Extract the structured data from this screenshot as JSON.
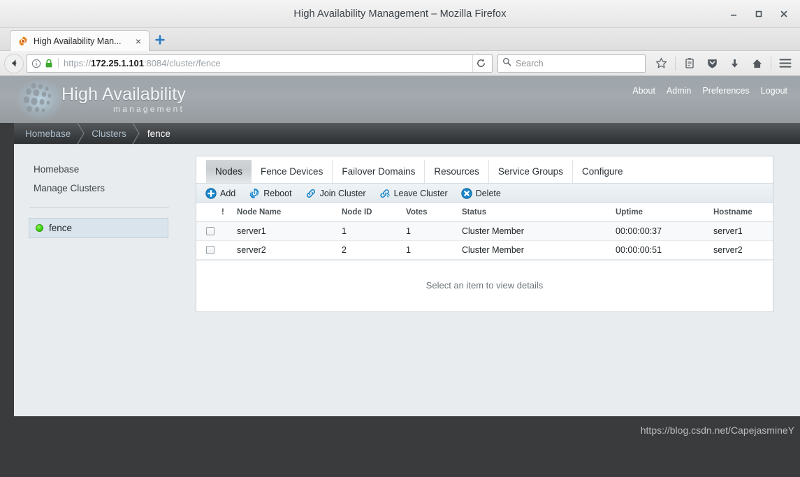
{
  "window": {
    "title": "High Availability Management – Mozilla Firefox",
    "minimize_label": "Minimize",
    "maximize_label": "Maximize",
    "close_label": "Close"
  },
  "browser": {
    "tab": {
      "title": "High Availability Man...",
      "favicon": "gear-icon",
      "close_label": "×"
    },
    "new_tab_label": "+",
    "url": {
      "scheme": "https://",
      "host": "172.25.1.101",
      "path": ":8084/cluster/fence",
      "full": "https://172.25.1.101:8084/cluster/fence"
    },
    "search": {
      "placeholder": "Search"
    },
    "icons": [
      "back-icon",
      "info-icon",
      "lock-icon",
      "reload-icon",
      "search-icon",
      "bookmark-star-icon",
      "reader-icon",
      "pocket-shield-icon",
      "download-icon",
      "home-icon",
      "menu-icon"
    ]
  },
  "header": {
    "brand_title": "High Availability",
    "brand_subtitle": "management",
    "nav": [
      {
        "label": "About"
      },
      {
        "label": "Admin"
      },
      {
        "label": "Preferences"
      },
      {
        "label": "Logout"
      }
    ]
  },
  "breadcrumb": [
    {
      "label": "Homebase",
      "current": false
    },
    {
      "label": "Clusters",
      "current": false
    },
    {
      "label": "fence",
      "current": true
    }
  ],
  "sidebar": {
    "links": [
      {
        "label": "Homebase"
      },
      {
        "label": "Manage Clusters"
      }
    ],
    "clusters": [
      {
        "label": "fence",
        "status": "running",
        "status_color": "#3fc413",
        "selected": true
      }
    ]
  },
  "main": {
    "tabs": [
      {
        "label": "Nodes",
        "active": true
      },
      {
        "label": "Fence Devices",
        "active": false
      },
      {
        "label": "Failover Domains",
        "active": false
      },
      {
        "label": "Resources",
        "active": false
      },
      {
        "label": "Service Groups",
        "active": false
      },
      {
        "label": "Configure",
        "active": false
      }
    ],
    "toolbar": [
      {
        "label": "Add",
        "icon": "plus-circle-icon"
      },
      {
        "label": "Reboot",
        "icon": "gear-power-icon"
      },
      {
        "label": "Join Cluster",
        "icon": "link-icon"
      },
      {
        "label": "Leave Cluster",
        "icon": "broken-link-icon"
      },
      {
        "label": "Delete",
        "icon": "x-circle-icon"
      }
    ],
    "table": {
      "columns": [
        "",
        "!",
        "Node Name",
        "Node ID",
        "Votes",
        "Status",
        "Uptime",
        "Hostname"
      ],
      "rows": [
        {
          "checked": false,
          "alert": "",
          "node_name": "server1",
          "node_id": "1",
          "votes": "1",
          "status": "Cluster Member",
          "uptime": "00:00:00:37",
          "hostname": "server1"
        },
        {
          "checked": false,
          "alert": "",
          "node_name": "server2",
          "node_id": "2",
          "votes": "1",
          "status": "Cluster Member",
          "uptime": "00:00:00:51",
          "hostname": "server2"
        }
      ]
    },
    "details_placeholder": "Select an item to view details"
  },
  "watermark": "https://blog.csdn.net/CapejasmineY",
  "colors": {
    "accent_blue": "#1f8ccc",
    "status_green": "#3fc413",
    "page_bg": "#e8ecef",
    "desktop_bg": "#393b3d"
  }
}
